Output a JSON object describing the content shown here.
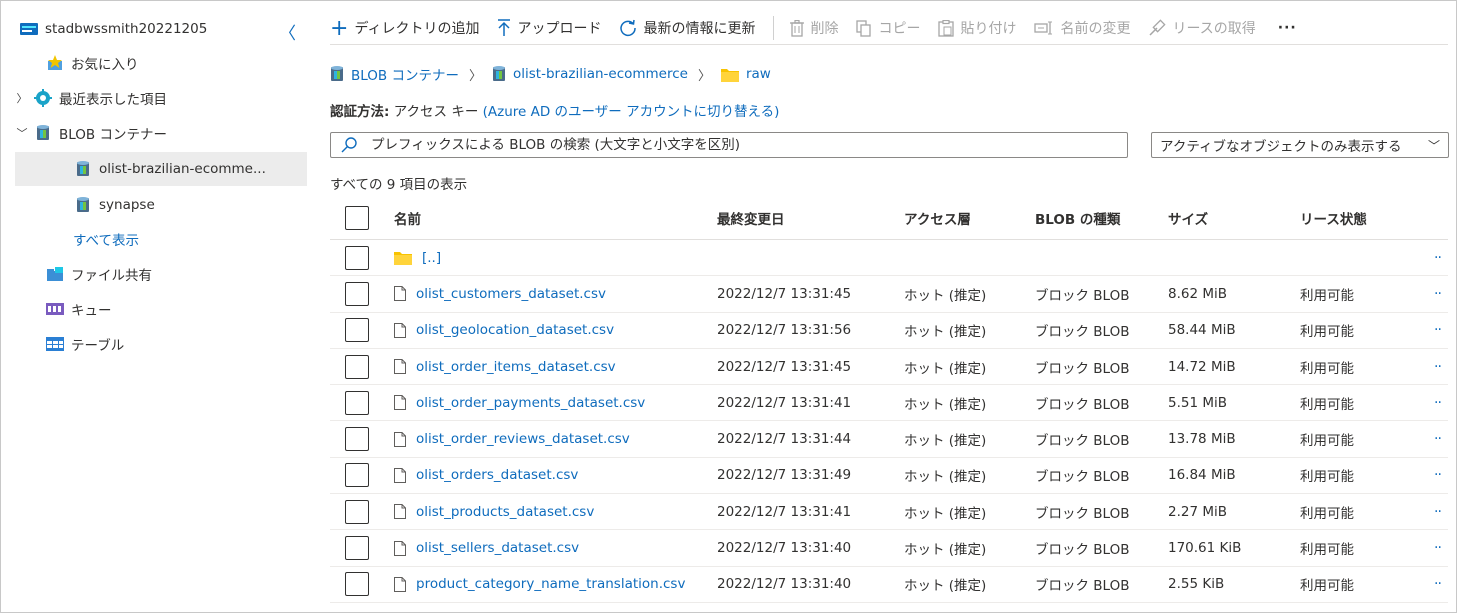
{
  "sidebar": {
    "collapse_glyph": "〈",
    "items": [
      {
        "label": "stadbwssmith20221205",
        "icon": "storage-account-icon"
      },
      {
        "label": "お気に入り",
        "icon": "favorites-star-icon"
      },
      {
        "label": "最近表示した項目",
        "icon": "recent-gear-icon",
        "chevron": "〉"
      },
      {
        "label": "BLOB コンテナー",
        "icon": "blob-container-icon",
        "chevron": "﹀"
      },
      {
        "label": "olist-brazilian-ecomme...",
        "icon": "blob-container-icon",
        "selected": true
      },
      {
        "label": "synapse",
        "icon": "blob-container-icon"
      },
      {
        "label": "すべて表示",
        "link": true
      },
      {
        "label": "ファイル共有",
        "icon": "file-share-icon"
      },
      {
        "label": "キュー",
        "icon": "queue-icon"
      },
      {
        "label": "テーブル",
        "icon": "table-icon"
      }
    ]
  },
  "toolbar": {
    "add_directory": "ディレクトリの追加",
    "upload": "アップロード",
    "refresh": "最新の情報に更新",
    "delete": "削除",
    "copy": "コピー",
    "paste": "貼り付け",
    "rename": "名前の変更",
    "acquire_lease": "リースの取得",
    "more": "···"
  },
  "breadcrumb": {
    "items": [
      "BLOB コンテナー",
      "olist-brazilian-ecommerce",
      "raw"
    ],
    "separator": "〉"
  },
  "auth": {
    "label": "認証方法:",
    "value": "アクセス キー",
    "switch_link": "(Azure AD のユーザー アカウントに切り替える)"
  },
  "search": {
    "placeholder": "プレフィックスによる BLOB の検索 (大文字と小文字を区別)"
  },
  "filter_dropdown": {
    "selected": "アクティブなオブジェクトのみ表示する",
    "chevron": "﹀"
  },
  "item_count": "すべての 9 項目の表示",
  "table": {
    "columns": {
      "name": "名前",
      "modified": "最終変更日",
      "tier": "アクセス層",
      "blob_type": "BLOB の種類",
      "size": "サイズ",
      "lease": "リース状態"
    },
    "parent_row": {
      "name": "[..]",
      "more": "··"
    },
    "rows": [
      {
        "name": "olist_customers_dataset.csv",
        "modified": "2022/12/7 13:31:45",
        "tier": "ホット (推定)",
        "blob_type": "ブロック BLOB",
        "size": "8.62 MiB",
        "lease": "利用可能",
        "more": "··"
      },
      {
        "name": "olist_geolocation_dataset.csv",
        "modified": "2022/12/7 13:31:56",
        "tier": "ホット (推定)",
        "blob_type": "ブロック BLOB",
        "size": "58.44 MiB",
        "lease": "利用可能",
        "more": "··"
      },
      {
        "name": "olist_order_items_dataset.csv",
        "modified": "2022/12/7 13:31:45",
        "tier": "ホット (推定)",
        "blob_type": "ブロック BLOB",
        "size": "14.72 MiB",
        "lease": "利用可能",
        "more": "··"
      },
      {
        "name": "olist_order_payments_dataset.csv",
        "modified": "2022/12/7 13:31:41",
        "tier": "ホット (推定)",
        "blob_type": "ブロック BLOB",
        "size": "5.51 MiB",
        "lease": "利用可能",
        "more": "··"
      },
      {
        "name": "olist_order_reviews_dataset.csv",
        "modified": "2022/12/7 13:31:44",
        "tier": "ホット (推定)",
        "blob_type": "ブロック BLOB",
        "size": "13.78 MiB",
        "lease": "利用可能",
        "more": "··"
      },
      {
        "name": "olist_orders_dataset.csv",
        "modified": "2022/12/7 13:31:49",
        "tier": "ホット (推定)",
        "blob_type": "ブロック BLOB",
        "size": "16.84 MiB",
        "lease": "利用可能",
        "more": "··"
      },
      {
        "name": "olist_products_dataset.csv",
        "modified": "2022/12/7 13:31:41",
        "tier": "ホット (推定)",
        "blob_type": "ブロック BLOB",
        "size": "2.27 MiB",
        "lease": "利用可能",
        "more": "··"
      },
      {
        "name": "olist_sellers_dataset.csv",
        "modified": "2022/12/7 13:31:40",
        "tier": "ホット (推定)",
        "blob_type": "ブロック BLOB",
        "size": "170.61 KiB",
        "lease": "利用可能",
        "more": "··"
      },
      {
        "name": "product_category_name_translation.csv",
        "modified": "2022/12/7 13:31:40",
        "tier": "ホット (推定)",
        "blob_type": "ブロック BLOB",
        "size": "2.55 KiB",
        "lease": "利用可能",
        "more": "··"
      }
    ]
  },
  "colors": {
    "accent": "#0f6cbd",
    "folder": "#f8c300",
    "selected_bg": "#ececec",
    "disabled": "#a6a6a6"
  }
}
